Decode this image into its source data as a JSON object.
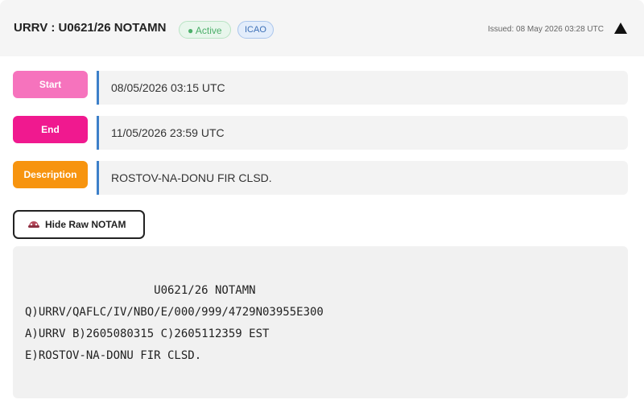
{
  "header": {
    "title": "URRV : U0621/26 NOTAMN",
    "status_badge": "● Active",
    "source_badge": "ICAO",
    "issued": "Issued: 08 May 2026 03:28 UTC",
    "collapse_icon": "triangle-up-icon"
  },
  "fields": {
    "start": {
      "label": "Start",
      "value": "08/05/2026 03:15 UTC"
    },
    "end": {
      "label": "End",
      "value": "11/05/2026 23:59 UTC"
    },
    "description": {
      "label": "Description",
      "value": "ROSTOV-NA-DONU FIR CLSD."
    }
  },
  "raw": {
    "toggle_label": "Hide Raw NOTAM",
    "toggle_icon": "hide-icon",
    "lines": [
      "                   U0621/26 NOTAMN",
      "Q)URRV/QAFLC/IV/NBO/E/000/999/4729N03955E300",
      "A)URRV B)2605080315 C)2605112359 EST",
      "E)ROSTOV-NA-DONU FIR CLSD."
    ]
  },
  "colors": {
    "start_label": "#f673bd",
    "end_label": "#f0198f",
    "description_label": "#f7940f",
    "value_accent": "#3d80c9",
    "active_badge": "#4caf6a",
    "icao_badge": "#3c6fb6"
  }
}
